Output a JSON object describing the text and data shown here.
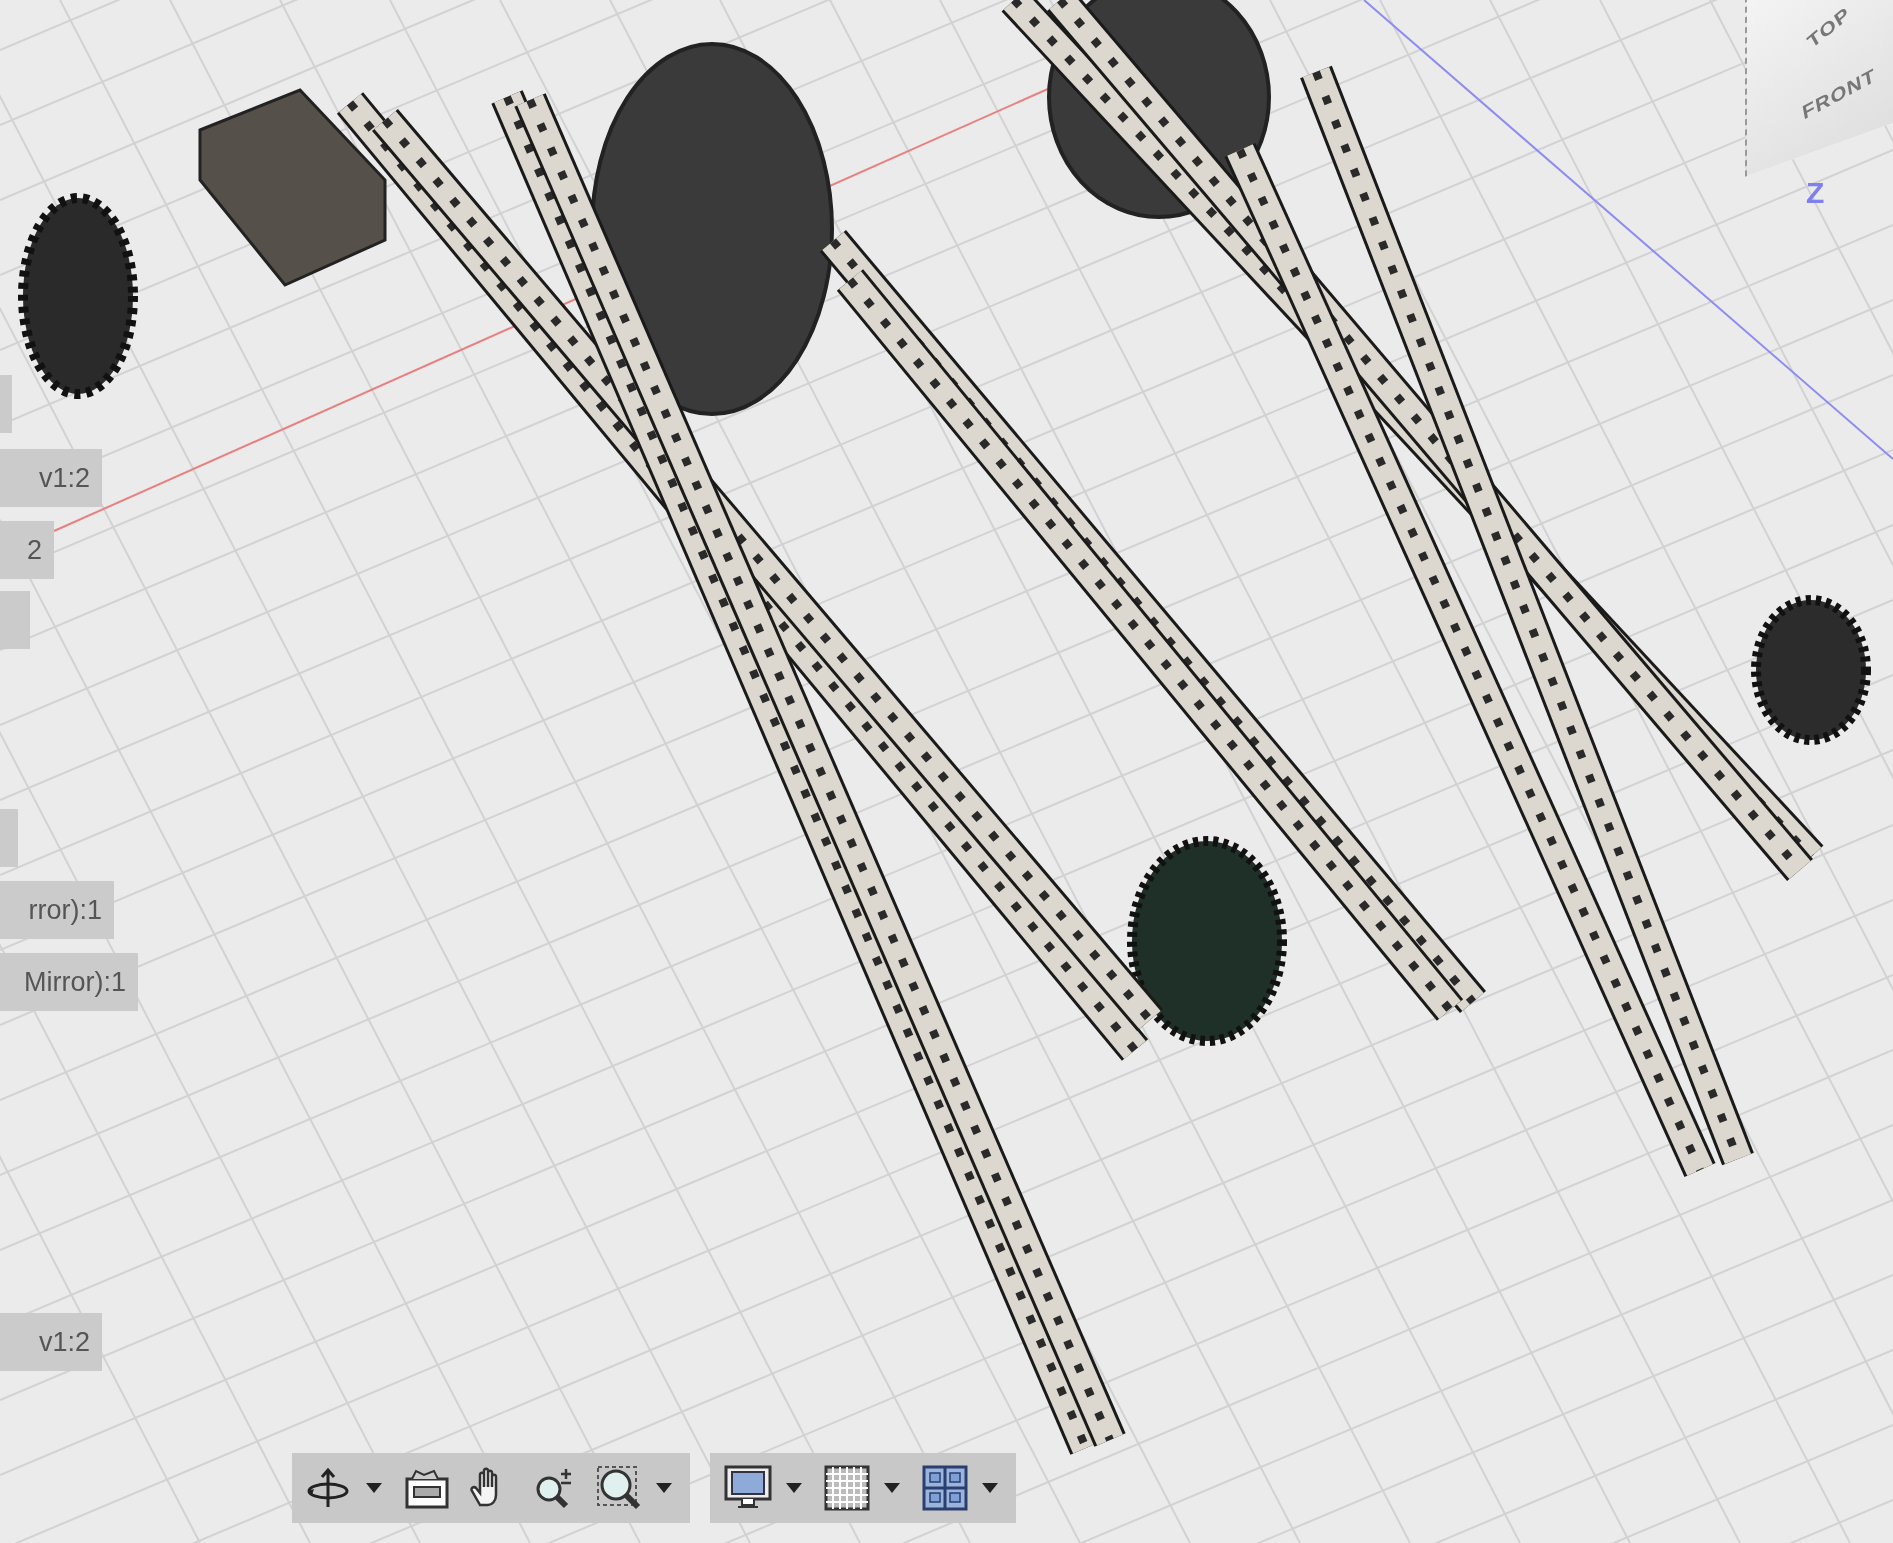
{
  "labels": [
    {
      "kind": "stub"
    },
    {
      "kind": "text",
      "text": "v1:2"
    },
    {
      "kind": "text",
      "text": "2"
    },
    {
      "kind": "stub"
    },
    {
      "kind": "stub"
    },
    {
      "kind": "text",
      "text": "rror):1"
    },
    {
      "kind": "text",
      "text": "Mirror):1"
    },
    {
      "kind": "text",
      "text": "v1:2"
    }
  ],
  "view_cube": {
    "faces": [
      "TOP",
      "FRONT"
    ],
    "axis_label": "Z"
  },
  "toolbar": [
    [
      {
        "kind": "orbit",
        "dropdown": true
      },
      {
        "kind": "look-at",
        "dropdown": false
      },
      {
        "kind": "pan",
        "dropdown": false
      },
      {
        "kind": "zoom",
        "dropdown": false
      },
      {
        "kind": "fit",
        "dropdown": true
      }
    ],
    [
      {
        "kind": "display",
        "dropdown": true
      },
      {
        "kind": "grid",
        "dropdown": true
      },
      {
        "kind": "viewports",
        "dropdown": true
      }
    ]
  ]
}
